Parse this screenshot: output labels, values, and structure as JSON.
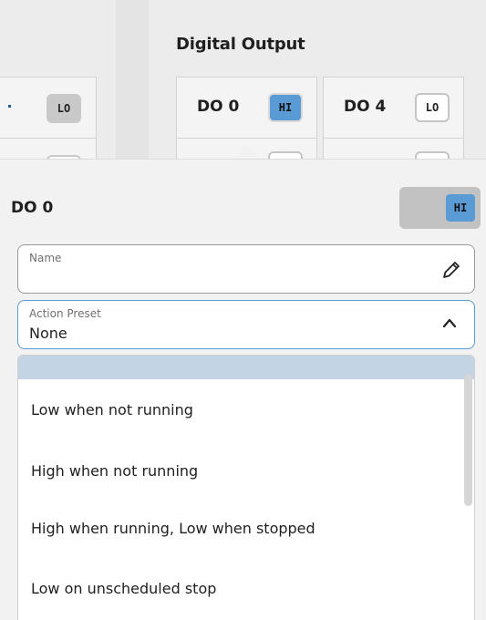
{
  "section": {
    "title": "Digital Output"
  },
  "tiles": {
    "partial_left": {
      "badge": "LO"
    },
    "do0": {
      "label": "DO 0",
      "badge": "HI"
    },
    "do4": {
      "label": "DO 4",
      "badge": "LO"
    }
  },
  "panel": {
    "title": "DO 0",
    "toggle_state": "HI"
  },
  "name_field": {
    "label": "Name",
    "value": ""
  },
  "action_preset": {
    "label": "Action Preset",
    "value": "None"
  },
  "dropdown": {
    "options": [
      "Low when not running",
      "High when not running",
      "High when running, Low when stopped",
      "Low on unscheduled stop"
    ]
  },
  "colors": {
    "accent": "#5b9bd5",
    "highlight": "#c3d4e4"
  }
}
